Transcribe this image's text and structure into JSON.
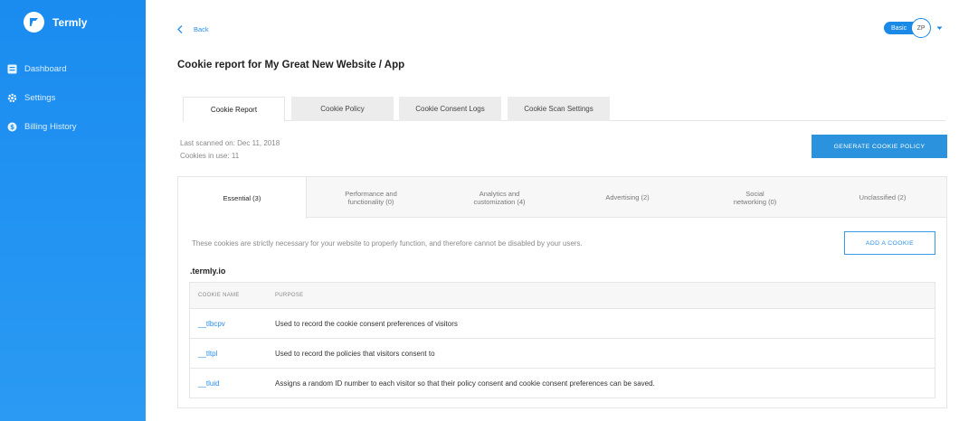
{
  "app": {
    "name": "Termly"
  },
  "sidebar": {
    "items": [
      {
        "label": "Dashboard",
        "icon": "dashboard-icon"
      },
      {
        "label": "Settings",
        "icon": "gear-icon"
      },
      {
        "label": "Billing History",
        "icon": "dollar-icon"
      }
    ]
  },
  "header": {
    "back_label": "Back",
    "title": "Cookie report for My Great New Website / App",
    "plan": "Basic",
    "user_initials": "ZP"
  },
  "main_tabs": [
    "Cookie Report",
    "Cookie Policy",
    "Cookie Consent Logs",
    "Cookie Scan Settings"
  ],
  "scan": {
    "last_scanned": "Last scanned on: Dec 11, 2018",
    "cookies_in_use": "Cookies in use: 11",
    "generate_label": "GENERATE COOKIE POLICY"
  },
  "categories": [
    {
      "line1": "Essential (3)",
      "line2": ""
    },
    {
      "line1": "Performance and",
      "line2": "functionality (0)"
    },
    {
      "line1": "Analytics and",
      "line2": "customization (4)"
    },
    {
      "line1": "Advertising (2)",
      "line2": ""
    },
    {
      "line1": "Social",
      "line2": "networking (0)"
    },
    {
      "line1": "Unclassified (2)",
      "line2": ""
    }
  ],
  "panel": {
    "description": "These cookies are strictly necessary for your website to properly function, and therefore cannot be disabled by your users.",
    "add_label": "ADD A COOKIE",
    "domain": ".termly.io",
    "columns": [
      "COOKIE NAME",
      "PURPOSE"
    ],
    "rows": [
      {
        "name": "__tlbcpv",
        "purpose": "Used to record the cookie consent preferences of visitors"
      },
      {
        "name": "__tltpl",
        "purpose": "Used to record the policies that visitors consent to"
      },
      {
        "name": "__tluid",
        "purpose": "Assigns a random ID number to each visitor so that their policy consent and cookie consent preferences can be saved."
      }
    ]
  },
  "colors": {
    "accent": "#2a8ee8",
    "sidebar": "#1a8cf0"
  }
}
